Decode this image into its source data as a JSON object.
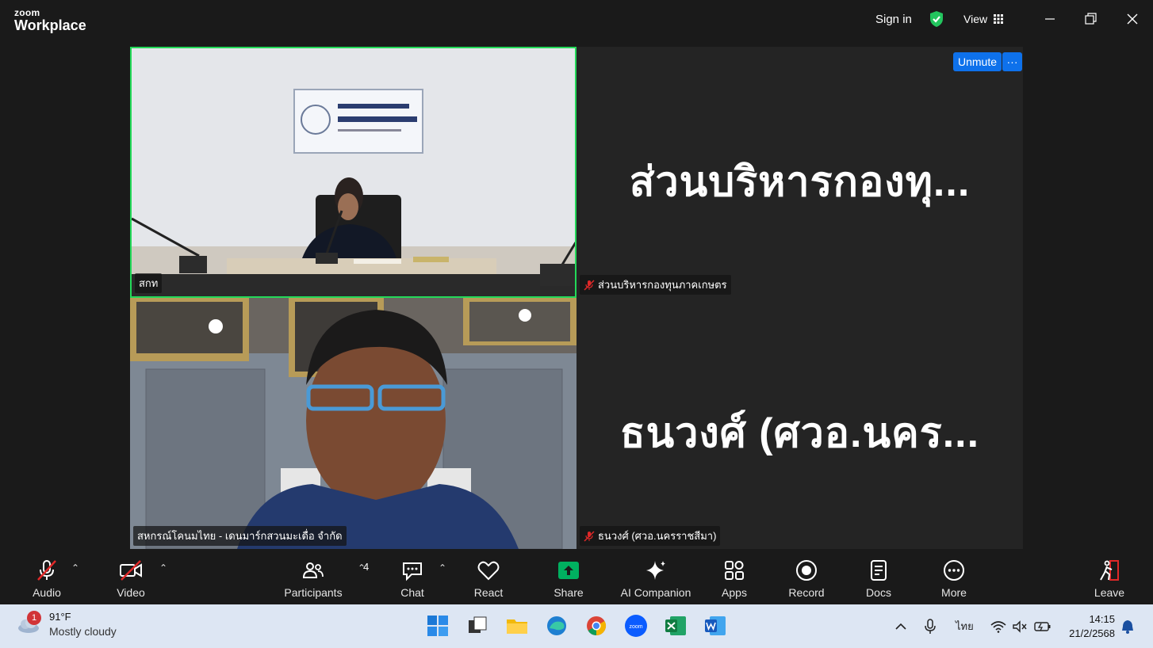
{
  "app": {
    "brand_top": "zoom",
    "brand_bottom": "Workplace"
  },
  "titlebar": {
    "signin": "Sign in",
    "view": "View"
  },
  "meeting": {
    "unmute_label": "Unmute",
    "more_label": "···",
    "tiles": [
      {
        "name": "สกท",
        "muted": false,
        "active": true
      },
      {
        "display_name": "ส่วนบริหารกองทุ...",
        "name": "ส่วนบริหารกองทุนภาคเกษตร",
        "muted": true
      },
      {
        "name": "สหกรณ์โคนมไทย - เดนมาร์กสวนมะเดื่อ จำกัด",
        "muted": false
      },
      {
        "display_name": "ธนวงศ์ (ศวอ.นคร...",
        "name": "ธนวงศ์ (ศวอ.นครราชสีมา)",
        "muted": true
      }
    ]
  },
  "toolbar": {
    "audio": "Audio",
    "video": "Video",
    "participants": "Participants",
    "participants_count": "4",
    "chat": "Chat",
    "react": "React",
    "share": "Share",
    "ai": "AI Companion",
    "apps": "Apps",
    "record": "Record",
    "docs": "Docs",
    "more": "More",
    "leave": "Leave"
  },
  "taskbar": {
    "weather_temp": "91°F",
    "weather_desc": "Mostly cloudy",
    "weather_badge": "1",
    "lang": "ไทย",
    "time": "14:15",
    "date": "21/2/2568"
  },
  "colors": {
    "accent": "#0e71eb",
    "active_border": "#23d959",
    "muted_red": "#e02828",
    "share_green": "#00b060"
  }
}
